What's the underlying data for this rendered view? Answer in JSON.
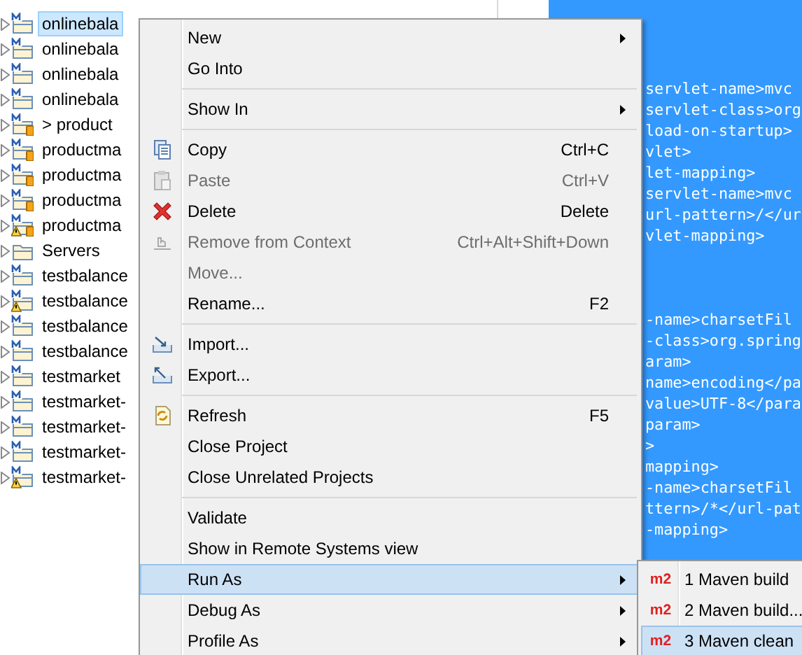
{
  "project_tree": {
    "items": [
      {
        "label": "onlinebala",
        "kind": "maven",
        "warning": false,
        "selected": true
      },
      {
        "label": "onlinebala",
        "kind": "maven",
        "warning": false,
        "selected": false
      },
      {
        "label": "onlinebala",
        "kind": "maven",
        "warning": false,
        "selected": false
      },
      {
        "label": "onlinebala",
        "kind": "maven",
        "warning": false,
        "selected": false
      },
      {
        "label": "> product",
        "kind": "maven-jar",
        "warning": false,
        "selected": false
      },
      {
        "label": "productma",
        "kind": "maven-jar",
        "warning": false,
        "selected": false
      },
      {
        "label": "productma",
        "kind": "maven-jar",
        "warning": false,
        "selected": false
      },
      {
        "label": "productma",
        "kind": "maven-jar",
        "warning": false,
        "selected": false
      },
      {
        "label": "productma",
        "kind": "maven-jar",
        "warning": true,
        "selected": false
      },
      {
        "label": "Servers",
        "kind": "folder",
        "warning": false,
        "selected": false
      },
      {
        "label": "testbalance",
        "kind": "maven",
        "warning": false,
        "selected": false
      },
      {
        "label": "testbalance",
        "kind": "maven",
        "warning": true,
        "selected": false
      },
      {
        "label": "testbalance",
        "kind": "maven",
        "warning": false,
        "selected": false
      },
      {
        "label": "testbalance",
        "kind": "maven",
        "warning": false,
        "selected": false
      },
      {
        "label": "testmarket",
        "kind": "maven",
        "warning": false,
        "selected": false
      },
      {
        "label": "testmarket-",
        "kind": "maven",
        "warning": false,
        "selected": false
      },
      {
        "label": "testmarket-",
        "kind": "maven",
        "warning": false,
        "selected": false
      },
      {
        "label": "testmarket-",
        "kind": "maven",
        "warning": false,
        "selected": false
      },
      {
        "label": "testmarket-",
        "kind": "maven",
        "warning": true,
        "selected": false
      }
    ]
  },
  "editor": {
    "blocks": [
      [
        "servlet-name>mvc",
        "servlet-class>org",
        "load-on-startup>",
        "vlet>",
        "let-mapping>",
        "servlet-name>mvc",
        "url-pattern>/</ur",
        "vlet-mapping>"
      ],
      [
        "-name>charsetFil",
        "-class>org.spring",
        "aram>",
        "name>encoding</pa",
        "value>UTF-8</para",
        "param>",
        ">",
        "mapping>",
        "-name>charsetFil",
        "ttern>/*</url-pat",
        "-mapping>"
      ]
    ]
  },
  "context_menu": {
    "items": [
      {
        "kind": "plain",
        "label": "New",
        "submenu": true,
        "disabled": false,
        "selected": false
      },
      {
        "kind": "plain",
        "label": "Go Into",
        "submenu": false,
        "disabled": false,
        "selected": false
      },
      {
        "kind": "separator"
      },
      {
        "kind": "plain",
        "label": "Show In",
        "submenu": true,
        "disabled": false,
        "selected": false
      },
      {
        "kind": "separator"
      },
      {
        "kind": "copy",
        "label": "Copy",
        "shortcut": "Ctrl+C",
        "submenu": false,
        "disabled": false,
        "selected": false
      },
      {
        "kind": "paste",
        "label": "Paste",
        "shortcut": "Ctrl+V",
        "submenu": false,
        "disabled": true,
        "selected": false
      },
      {
        "kind": "delete",
        "label": "Delete",
        "shortcut": "Delete",
        "submenu": false,
        "disabled": false,
        "selected": false
      },
      {
        "kind": "remove",
        "label": "Remove from Context",
        "shortcut": "Ctrl+Alt+Shift+Down",
        "submenu": false,
        "disabled": true,
        "selected": false
      },
      {
        "kind": "plain",
        "label": "Move...",
        "submenu": false,
        "disabled": true,
        "selected": false
      },
      {
        "kind": "plain",
        "label": "Rename...",
        "shortcut": "F2",
        "submenu": false,
        "disabled": false,
        "selected": false
      },
      {
        "kind": "separator"
      },
      {
        "kind": "import",
        "label": "Import...",
        "submenu": false,
        "disabled": false,
        "selected": false
      },
      {
        "kind": "export",
        "label": "Export...",
        "submenu": false,
        "disabled": false,
        "selected": false
      },
      {
        "kind": "separator"
      },
      {
        "kind": "refresh",
        "label": "Refresh",
        "shortcut": "F5",
        "submenu": false,
        "disabled": false,
        "selected": false
      },
      {
        "kind": "plain",
        "label": "Close Project",
        "submenu": false,
        "disabled": false,
        "selected": false
      },
      {
        "kind": "plain",
        "label": "Close Unrelated Projects",
        "submenu": false,
        "disabled": false,
        "selected": false
      },
      {
        "kind": "separator"
      },
      {
        "kind": "plain",
        "label": "Validate",
        "submenu": false,
        "disabled": false,
        "selected": false
      },
      {
        "kind": "plain",
        "label": "Show in Remote Systems view",
        "submenu": false,
        "disabled": false,
        "selected": false
      },
      {
        "kind": "plain",
        "label": "Run As",
        "submenu": true,
        "disabled": false,
        "selected": true
      },
      {
        "kind": "plain",
        "label": "Debug As",
        "submenu": true,
        "disabled": false,
        "selected": false
      },
      {
        "kind": "plain",
        "label": "Profile As",
        "submenu": true,
        "disabled": false,
        "selected": false
      }
    ]
  },
  "run_as_submenu": {
    "items": [
      {
        "badge": "m2",
        "label": "1 Maven build",
        "selected": false
      },
      {
        "badge": "m2",
        "label": "2 Maven build...",
        "selected": false
      },
      {
        "badge": "m2",
        "label": "3 Maven clean",
        "selected": true
      }
    ]
  }
}
